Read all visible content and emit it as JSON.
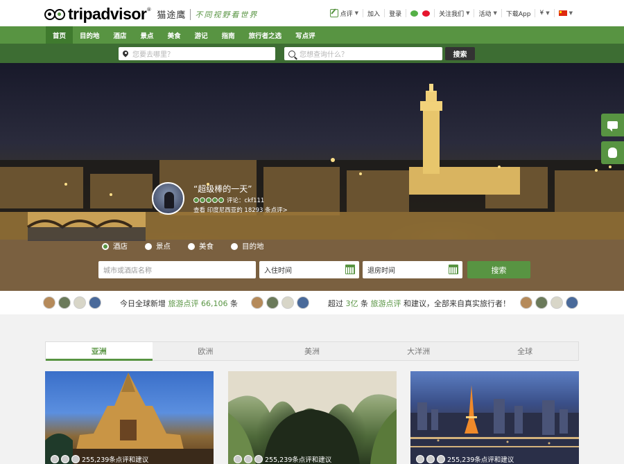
{
  "brand": {
    "name": "tripadvisor",
    "mark": "®",
    "cn_name": "猫途鹰",
    "slogan": "不同视野看世界"
  },
  "topnav": {
    "review": "点评",
    "join": "加入",
    "login": "登录",
    "follow": "关注我们",
    "activity": "活动",
    "app": "下载App",
    "currency": "¥"
  },
  "mainnav": [
    "首页",
    "目的地",
    "酒店",
    "景点",
    "美食",
    "游记",
    "指南",
    "旅行者之选",
    "写点评"
  ],
  "search": {
    "where_placeholder": "您要去哪里？",
    "what_placeholder": "您想查询什么？",
    "button": "搜索"
  },
  "hero": {
    "quote": "“超级棒的一天”",
    "rating_text": "评论：ckf111",
    "meta": "查看 印度尼西亚的 18293 条点评>",
    "radios": [
      "酒店",
      "景点",
      "美食",
      "目的地"
    ],
    "city_placeholder": "城市或酒店名称",
    "checkin": "入住时间",
    "checkout": "退房时间",
    "search_button": "搜索"
  },
  "stats": {
    "left_prefix": "今日全球新增",
    "left_link": "旅游点评",
    "left_count": "66,106",
    "left_suffix": "条",
    "right_prefix": "超过",
    "right_count": "3亿",
    "right_mid": "条",
    "right_link": "旅游点评",
    "right_suffix": "和建议，全部来自真实旅行者！"
  },
  "tabs": [
    "亚洲",
    "欧洲",
    "美洲",
    "大洋洲",
    "全球"
  ],
  "cards": [
    {
      "caption": "255,239条点评和建议"
    },
    {
      "caption": "255,239条点评和建议"
    },
    {
      "caption": "255,239条点评和建议"
    }
  ],
  "colors": {
    "brand_green": "#589442",
    "dark_green": "#3d6d33",
    "active_nav": "#3f7a2e"
  }
}
